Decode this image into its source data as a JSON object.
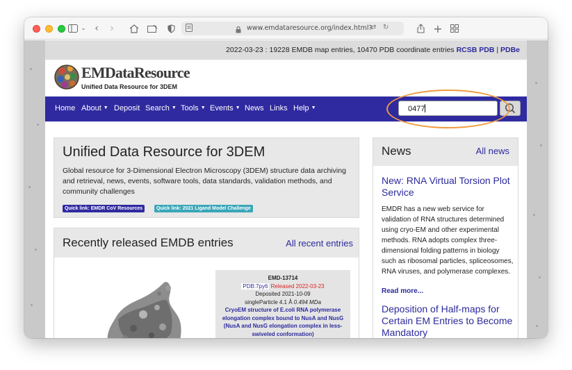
{
  "browser": {
    "url": "www.emdataresource.org/index.html?",
    "icons": [
      "sidebar-icon",
      "chevron-down-icon",
      "back-icon",
      "forward-icon",
      "home-icon",
      "reading-list-icon",
      "privacy-shield-icon",
      "page-icon",
      "lock-icon",
      "translate-icon",
      "reload-icon",
      "share-icon",
      "new-tab-icon",
      "tab-overview-icon"
    ]
  },
  "topbar": {
    "stats_text": "2022-03-23 : 19228 EMDB map entries, 10470 PDB coordinate entries ",
    "rcsb_link": "RCSB PDB",
    "separator": " | ",
    "pdbe_link": "PDBe"
  },
  "brand": {
    "name": "EMDataResource",
    "subtitle": "Unified Data Resource for 3DEM"
  },
  "nav": {
    "items": [
      "Home",
      "About",
      "Deposit",
      "Search",
      "Tools",
      "Events",
      "News",
      "Links",
      "Help"
    ],
    "search_value": "0477"
  },
  "hero": {
    "title": "Unified Data Resource for 3DEM",
    "description": "Global resource for 3-Dimensional Electron Microscopy (3DEM) structure data archiving and retrieval, news, events, software tools, data standards, validation methods, and community challenges",
    "quick_link_1": "Quick link: EMDR CoV Resources",
    "quick_link_2": "Quick link: 2021 Ligand Model Challenge"
  },
  "recent": {
    "title": "Recently released EMDB entries",
    "all_link": "All recent entries",
    "entry": {
      "id": "EMD-13714",
      "pdb": "PDB:7py6",
      "released": "Released 2022-03-23",
      "deposited": "Deposited 2021-10-09",
      "method": "singleParticle 4.1 Å ",
      "size": "0.494 MDa",
      "title": "CryoEM structure of E.coli RNA polymerase elongation complex bound to NusA and NusG (NusA and NusG elongation complex in less-swiveled conformation)"
    }
  },
  "news": {
    "title": "News",
    "all_link": "All news",
    "item1_title": "New: RNA Virtual Torsion Plot Service",
    "item1_body": "EMDR has a new web service for validation of RNA structures determined using cryo-EM and other experimental methods. RNA adopts complex three-dimensional folding patterns in biology such as ribosomal particles, spliceosomes, RNA viruses, and polymerase complexes.",
    "read_more": "Read more...",
    "item2_title": "Deposition of Half-maps for Certain EM Entries to Become Mandatory"
  },
  "colors": {
    "nav_bg": "#2f2aa0",
    "link": "#2c2a9c",
    "annotation": "#ef9b3d",
    "released": "#dd2222"
  }
}
